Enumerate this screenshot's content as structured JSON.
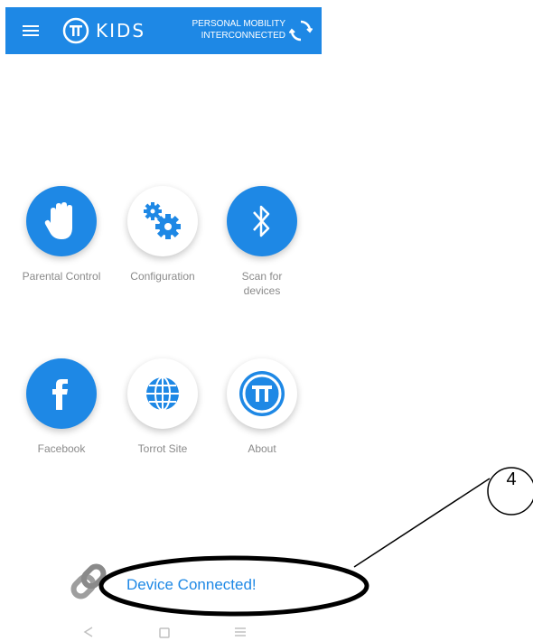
{
  "app": {
    "brand_text": "KIDS",
    "tagline_line1": "PERSONAL MOBILITY",
    "tagline_line2": "INTERCONNECTED",
    "menu_icon": "hamburger-menu-icon",
    "logo_icon": "torrot-logo-icon",
    "refresh_icon": "refresh-icon"
  },
  "tiles": [
    {
      "label_line1": "Parental Control",
      "label_line2": "",
      "icon": "hand-stop-icon",
      "style": "blue"
    },
    {
      "label_line1": "Configuration",
      "label_line2": "",
      "icon": "gears-icon",
      "style": "white"
    },
    {
      "label_line1": "Scan for",
      "label_line2": "devices",
      "icon": "bluetooth-icon",
      "style": "blue"
    },
    {
      "label_line1": "Facebook",
      "label_line2": "",
      "icon": "facebook-icon",
      "style": "blue"
    },
    {
      "label_line1": "Torrot Site",
      "label_line2": "",
      "icon": "globe-icon",
      "style": "white"
    },
    {
      "label_line1": "About",
      "label_line2": "",
      "icon": "torrot-logo-icon",
      "style": "white"
    }
  ],
  "status": {
    "text": "Device Connected!",
    "icon": "link-icon"
  },
  "annotation": {
    "number": "4"
  },
  "colors": {
    "brand_blue": "#1e88e5",
    "label_gray": "#8a8a8a"
  }
}
